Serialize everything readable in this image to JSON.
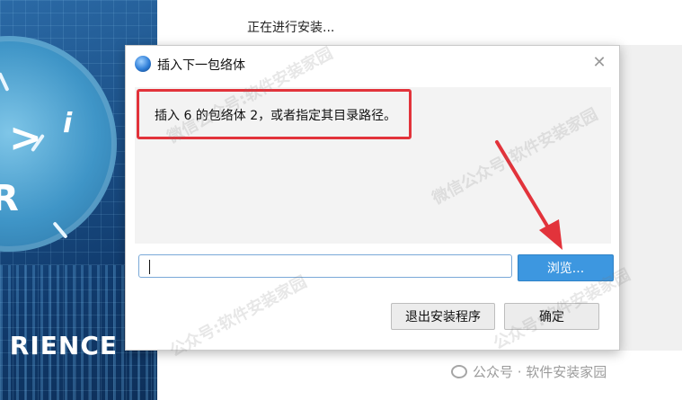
{
  "background": {
    "progress_text": "正在进行安装...",
    "brand_text": "RIENCE",
    "brand_glyphs": {
      "arrow": ">",
      "letter_i": "i",
      "letter_r": "R"
    }
  },
  "dialog": {
    "title": "插入下一包络体",
    "message": "插入 6 的包络体 2，或者指定其目录路径。",
    "path_value": "",
    "browse_label": "浏览...",
    "exit_label": "退出安装程序",
    "ok_label": "确定",
    "close_icon": "close-icon"
  },
  "watermarks": {
    "text_1": "微信公众号:软件安装家园",
    "text_2": "微信公众号:软件安装家园",
    "text_3": "公众号:软件安装家园",
    "text_4": "公众号:软件安装家园",
    "footer": "公众号 · 软件安装家园"
  },
  "colors": {
    "annotation_red": "#e2333b",
    "browse_blue": "#3d97e0",
    "banner_blue": "#1b4f86"
  }
}
